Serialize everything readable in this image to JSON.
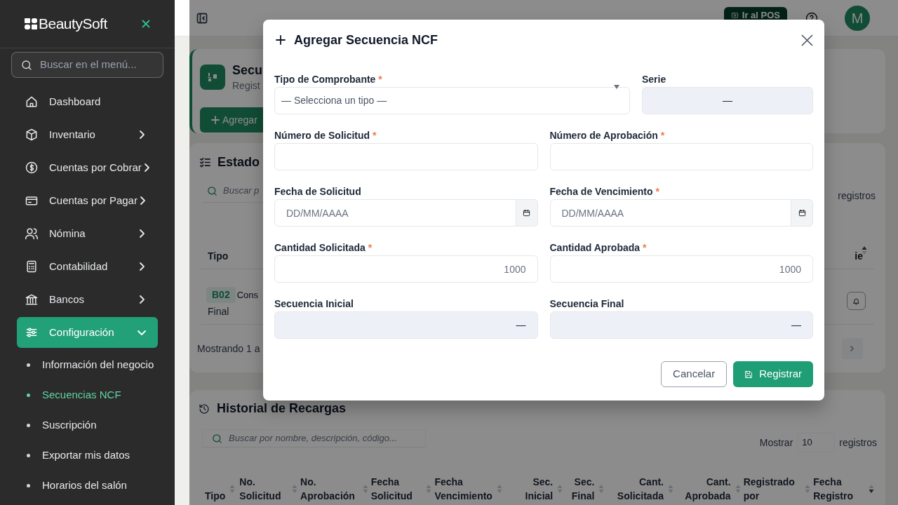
{
  "sidebar": {
    "brand": "BeautySoft",
    "search_placeholder": "Buscar en el menú...",
    "items": [
      {
        "label": "Dashboard",
        "selected": false
      },
      {
        "label": "Inventario",
        "selected": false,
        "expanded": false
      },
      {
        "label": "Cuentas por Cobrar",
        "selected": false,
        "expanded": false
      },
      {
        "label": "Cuentas por Pagar",
        "selected": false,
        "expanded": false
      },
      {
        "label": "Nómina",
        "selected": false,
        "expanded": false
      },
      {
        "label": "Contabilidad",
        "selected": false,
        "expanded": false
      },
      {
        "label": "Bancos",
        "selected": false,
        "expanded": false
      },
      {
        "label": "Configuración",
        "selected": true,
        "expanded": true,
        "children": [
          {
            "label": "Información del negocio",
            "selected": false
          },
          {
            "label": "Secuencias NCF",
            "selected": true
          },
          {
            "label": "Suscripción",
            "selected": false
          },
          {
            "label": "Exportar mis datos",
            "selected": false
          },
          {
            "label": "Horarios del salón",
            "selected": false
          }
        ]
      }
    ]
  },
  "topbar": {
    "pos_button": "Ir al POS",
    "avatar": "M"
  },
  "page_header": {
    "title": "Secu",
    "subtitle": "Regist",
    "add_button": "Agregar"
  },
  "status_card": {
    "title": "Estado",
    "search_placeholder": "Buscar p",
    "show_suffix": "registros",
    "columns": [
      {
        "label": "Tipo"
      },
      {
        "label": "ie",
        "sort_up": true,
        "sort_down": false
      }
    ],
    "rows": [
      {
        "code": "B02",
        "type_line1": "Cons",
        "type_line2": "Final"
      }
    ],
    "footer": "Mostrando 1 a"
  },
  "history_card": {
    "title": "Historial de Recargas",
    "search_placeholder": "Buscar por nombre, descripción, código...",
    "show_label": "Mostrar",
    "page_size": "10",
    "show_suffix": "registros",
    "columns": [
      {
        "label": "Tipo",
        "kind": "text",
        "sort_up": false,
        "sort_down": false
      },
      {
        "label": "No. Solicitud",
        "kind": "text",
        "sort_up": false,
        "sort_down": false
      },
      {
        "label": "No. Aprobación",
        "kind": "text",
        "sort_up": false,
        "sort_down": false
      },
      {
        "label": "Fecha Solicitud",
        "kind": "text",
        "sort_up": false,
        "sort_down": false
      },
      {
        "label": "Fecha Vencimiento",
        "kind": "text",
        "sort_up": false,
        "sort_down": false
      },
      {
        "label": "Sec. Inicial",
        "kind": "numeric",
        "sort_up": false,
        "sort_down": false
      },
      {
        "label": "Sec. Final",
        "kind": "numeric",
        "sort_up": false,
        "sort_down": false
      },
      {
        "label": "Cant. Solicitada",
        "kind": "numeric",
        "sort_up": false,
        "sort_down": false
      },
      {
        "label": "Cant. Aprobada",
        "kind": "numeric",
        "sort_up": false,
        "sort_down": false
      },
      {
        "label": "Registrado por",
        "kind": "text",
        "sort_up": false,
        "sort_down": false
      },
      {
        "label": "Fecha Registro",
        "kind": "text",
        "sort_up": false,
        "sort_down": true
      }
    ]
  },
  "modal": {
    "title": "Agregar Secuencia NCF",
    "rows": [
      [
        {
          "label": "Tipo de Comprobante",
          "required_mark": "*",
          "kind": "select",
          "placeholder": "— Selecciona un tipo —"
        },
        {
          "label": "Serie",
          "kind": "readonly",
          "value": "—"
        }
      ],
      [
        {
          "label": "Número de Solicitud",
          "required_mark": "*",
          "kind": "text"
        },
        {
          "label": "Número de Aprobación",
          "required_mark": "*",
          "kind": "text"
        }
      ],
      [
        {
          "label": "Fecha de Solicitud",
          "kind": "date",
          "placeholder": "DD/MM/AAAA"
        },
        {
          "label": "Fecha de Vencimiento",
          "required_mark": "*",
          "kind": "date",
          "placeholder": "DD/MM/AAAA"
        }
      ],
      [
        {
          "label": "Cantidad Solicitada",
          "required_mark": "*",
          "kind": "number",
          "placeholder": "1000"
        },
        {
          "label": "Cantidad Aprobada",
          "required_mark": "*",
          "kind": "number",
          "placeholder": "1000"
        }
      ],
      [
        {
          "label": "Secuencia Inicial",
          "kind": "readonly",
          "value": "—"
        },
        {
          "label": "Secuencia Final",
          "kind": "readonly",
          "value": "—"
        }
      ]
    ],
    "cancel_button": "Cancelar",
    "submit_button": "Registrar"
  }
}
